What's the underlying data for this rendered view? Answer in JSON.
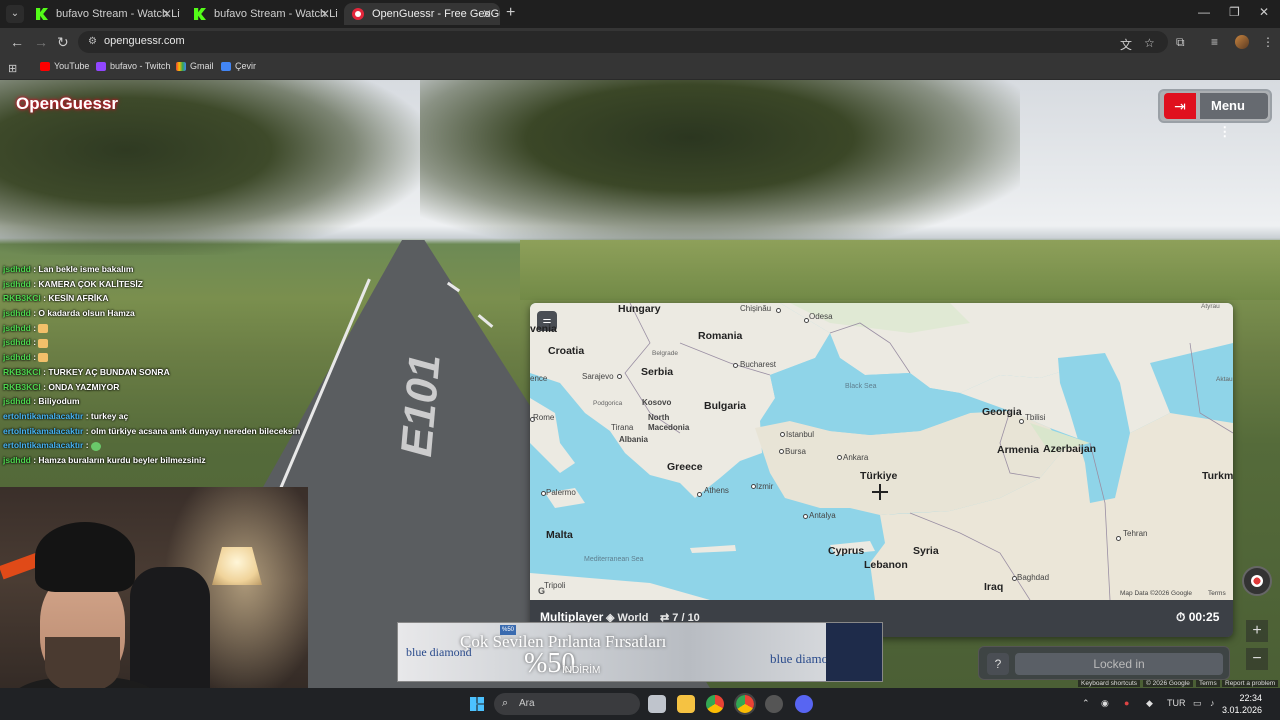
{
  "browser": {
    "tabs": [
      {
        "title": "bufavo Stream - Watch Live on",
        "active": false
      },
      {
        "title": "bufavo Stream - Watch Live on",
        "active": false
      },
      {
        "title": "OpenGuessr - Free GeoGue",
        "active": true
      }
    ],
    "url": "openguessr.com",
    "bookmarks": [
      "YouTube",
      "bufavo - Twitch",
      "Gmail",
      "Çevir"
    ]
  },
  "game": {
    "logo": "OpenGuessr",
    "menu_label": "Menu",
    "road_marking": "E101",
    "status": {
      "mode": "Multiplayer",
      "map": "World",
      "round": "7 / 10",
      "timer": "00:25"
    },
    "guess_button": "Locked in",
    "help_label": "?",
    "map_labels": {
      "countries": [
        "Hungary",
        "Romania",
        "Croatia",
        "Serbia",
        "Bulgaria",
        "Kosovo",
        "North Macedonia",
        "Albania",
        "Greece",
        "Türkiye",
        "Georgia",
        "Armenia",
        "Azerbaijan",
        "Syria",
        "Cyprus",
        "Lebanon",
        "Iraq",
        "Malta",
        "Turkm"
      ],
      "cities": [
        "Chișinău",
        "Odesa",
        "Bucharest",
        "Belgrade",
        "Sarajevo",
        "Podgorica",
        "Tirana",
        "Istanbul",
        "Bursa",
        "Ankara",
        "Izmir",
        "Athens",
        "Antalya",
        "Tbilisi",
        "Rome",
        "Palermo",
        "Tehran",
        "Baghdad",
        "Tripoli",
        "Aktau",
        "Atyrau"
      ],
      "seas": [
        "Black Sea",
        "Mediterranean Sea"
      ],
      "partial": [
        "venia",
        "ence"
      ]
    },
    "map_credit": "Map Data ©2026 Google",
    "map_terms": "Terms",
    "footer": [
      "Keyboard shortcuts",
      "© 2026 Google",
      "Terms",
      "Report a problem"
    ]
  },
  "chat": [
    {
      "user": "jsdhdd",
      "msg": "Lan bekle isme bakalım",
      "color": "green"
    },
    {
      "user": "jsdhdd",
      "msg": "KAMERA ÇOK KALİTESİZ",
      "color": "green"
    },
    {
      "user": "RKB3KCI",
      "msg": "KESİN AFRİKA",
      "color": "green"
    },
    {
      "user": "jsdhdd",
      "msg": "O kadarda olsun Hamza",
      "color": "green"
    },
    {
      "user": "jsdhdd",
      "msg": "",
      "color": "green"
    },
    {
      "user": "jsdhdd",
      "msg": "",
      "color": "green"
    },
    {
      "user": "jsdhdd",
      "msg": "",
      "color": "green"
    },
    {
      "user": "RKB3KCI",
      "msg": "TURKEY AÇ BUNDAN SONRA",
      "color": "green"
    },
    {
      "user": "RKB3KCI",
      "msg": "ONDA YAZMIYOR",
      "color": "green"
    },
    {
      "user": "jsdhdd",
      "msg": "Biliyodum",
      "color": "green"
    },
    {
      "user": "ertolntikamalacaktır",
      "msg": "turkey aç",
      "color": "blue"
    },
    {
      "user": "ertolntikamalacaktır",
      "msg": "olm türkiye acsana amk dunyayı nereden bileceksin",
      "color": "blue"
    },
    {
      "user": "ertolntikamalacaktır",
      "msg": "",
      "color": "blue"
    },
    {
      "user": "jsdhdd",
      "msg": "Hamza buraların kurdu beyler bilmezsiniz",
      "color": "green"
    }
  ],
  "ad": {
    "brand": "blue diamond",
    "headline": "Çok Sevilen Pırlanta Fırsatları",
    "percent": "%50",
    "word": "İNDİRİM",
    "badge": "%50"
  },
  "taskbar": {
    "search_placeholder": "Ara",
    "lang": "TUR",
    "time": "22:34",
    "date": "3.01.2026"
  }
}
